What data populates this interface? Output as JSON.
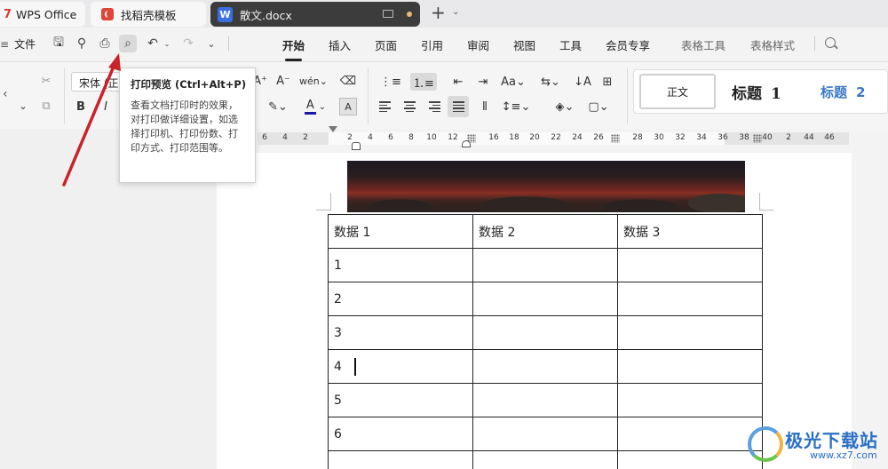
{
  "tabs": {
    "wps": "WPS Office",
    "templates": "找稻壳模板",
    "doc": "散文.docx",
    "doc_icon": "W"
  },
  "menu": {
    "file": "文件",
    "tabs": [
      "开始",
      "插入",
      "页面",
      "引用",
      "审阅",
      "视图",
      "工具",
      "会员专享",
      "表格工具",
      "表格样式"
    ]
  },
  "ribbon": {
    "font_name": "宋体 (正",
    "styles": {
      "normal": "正文",
      "h1": "标题",
      "h1_num": "1",
      "h2": "标题",
      "h2_num": "2"
    },
    "accent_colors": {
      "font_color_bar": "#1a1aa8",
      "heading2": "#3a78c8"
    }
  },
  "tooltip": {
    "title": "打印预览 (Ctrl+Alt+P)",
    "body": "查看文档打印时的效果，对打印做详细设置，如选择打印机、打印份数、打印方式、打印范围等。"
  },
  "ruler": {
    "numbers": [
      "6",
      "4",
      "2",
      "2",
      "4",
      "6",
      "8",
      "10",
      "12",
      "16",
      "18",
      "20",
      "22",
      "24",
      "26",
      "28",
      "30",
      "32",
      "34",
      "36",
      "38",
      "40",
      "2",
      "44",
      "46",
      "48"
    ]
  },
  "table": {
    "headers": [
      "数据 1",
      "数据 2",
      "数据 3"
    ],
    "rows": [
      [
        "1",
        "",
        ""
      ],
      [
        "2",
        "",
        ""
      ],
      [
        "3",
        "",
        ""
      ],
      [
        "4",
        "",
        ""
      ],
      [
        "5",
        "",
        ""
      ],
      [
        "6",
        "",
        ""
      ],
      [
        "",
        "",
        ""
      ]
    ]
  },
  "watermark": {
    "name": "极光下载站",
    "url": "www.xz7.com"
  }
}
